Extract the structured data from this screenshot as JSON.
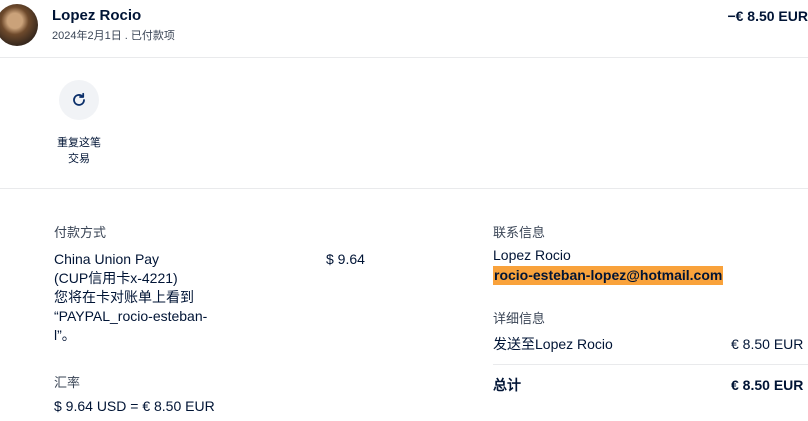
{
  "header": {
    "merchant_name": "Lopez Rocio",
    "date_status": "2024年2月1日 . 已付款项",
    "amount": "−€ 8.50 EUR"
  },
  "actions": {
    "repeat_label_line1": "重复这笔",
    "repeat_label_line2": "交易"
  },
  "payment": {
    "title": "付款方式",
    "method_line1": "China Union Pay",
    "method_line2": "(CUP信用卡x-4221)",
    "method_line3": "您将在卡对账单上看到",
    "method_line4": "“PAYPAL_rocio-esteban-",
    "method_line5": "l”。",
    "amount": "$ 9.64"
  },
  "exchange": {
    "title": "汇率",
    "rate": "$ 9.64 USD = € 8.50 EUR"
  },
  "contact": {
    "title": "联系信息",
    "name": "Lopez Rocio",
    "email": "rocio-esteban-lopez@hotmail.com"
  },
  "details": {
    "title": "详细信息",
    "sent_to_label": "发送至Lopez Rocio",
    "sent_to_amount": "€ 8.50 EUR",
    "total_label": "总计",
    "total_amount": "€ 8.50 EUR"
  },
  "icons": {
    "repeat": "refresh-icon"
  },
  "colors": {
    "highlight": "#f9a23b",
    "text": "#001435",
    "button_bg": "#f1f3f6"
  }
}
